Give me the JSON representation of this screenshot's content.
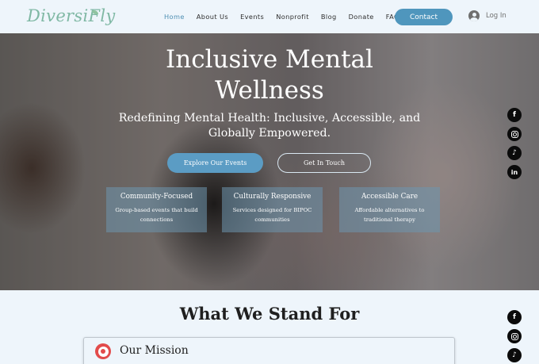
{
  "brand": {
    "logo_text": "DiversiFly"
  },
  "nav": {
    "items": [
      "Home",
      "About Us",
      "Events",
      "Nonprofit",
      "Blog",
      "Donate",
      "FAQ"
    ],
    "active": "Home"
  },
  "header": {
    "contact_label": "Contact",
    "login_label": "Log In"
  },
  "hero": {
    "title_line1": "Inclusive Mental",
    "title_line2": "Wellness",
    "subtitle": "Redefining Mental Health: Inclusive, Accessible, and Globally Empowered.",
    "primary_button": "Explore Our Events",
    "secondary_button": "Get In Touch",
    "cards": [
      {
        "title": "Community-Focused",
        "text": "Group-based events that build connections"
      },
      {
        "title": "Culturally Responsive",
        "text": "Services designed for BIPOC communities"
      },
      {
        "title": "Accessible Care",
        "text": "Affordable alternatives to traditional therapy"
      }
    ]
  },
  "social": {
    "icons": [
      "facebook-icon",
      "instagram-icon",
      "tiktok-icon",
      "linkedin-icon"
    ]
  },
  "values_section": {
    "title": "What We Stand For",
    "mission_title": "Our Mission"
  },
  "colors": {
    "accent": "#4f96bd",
    "logo": "#7fb8a4",
    "background": "#eef5fb"
  }
}
